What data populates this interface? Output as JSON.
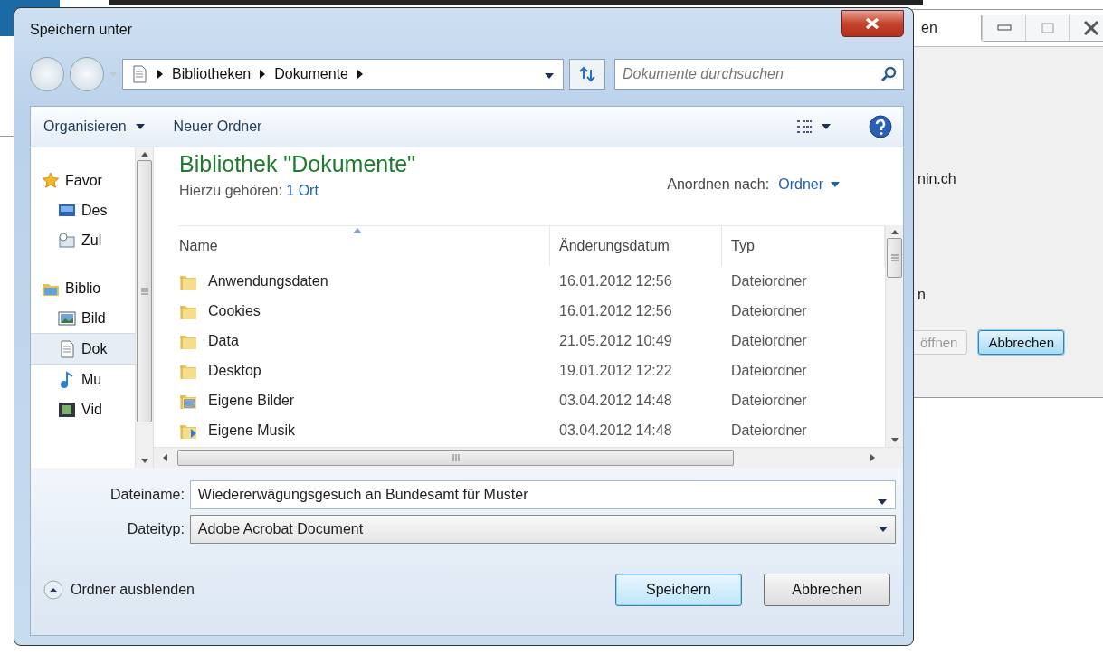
{
  "background_window": {
    "title": "en",
    "texts": [
      "nin.ch",
      "n"
    ],
    "buttons": [
      {
        "label": "öffnen",
        "disabled": true,
        "focused": false
      },
      {
        "label": "Abbrechen",
        "disabled": false,
        "focused": true
      }
    ]
  },
  "dialog": {
    "title": "Speichern unter",
    "breadcrumb": [
      "Bibliotheken",
      "Dokumente"
    ],
    "search": {
      "placeholder": "Dokumente durchsuchen"
    },
    "toolbar": [
      {
        "label": "Organisieren",
        "kind": "menu"
      },
      {
        "label": "Neuer Ordner",
        "kind": "button"
      }
    ],
    "nav_items": [
      {
        "label": "Favor",
        "kind": "favorites",
        "selected": false,
        "children": [
          {
            "label": "Des",
            "kind": "desktop",
            "selected": false
          },
          {
            "label": "Zul",
            "kind": "recent",
            "selected": false
          }
        ]
      },
      {
        "label": "Biblio",
        "kind": "libraries",
        "selected": false,
        "children": [
          {
            "label": "Bild",
            "kind": "pictures",
            "selected": false
          },
          {
            "label": "Dok",
            "kind": "documents",
            "selected": true
          },
          {
            "label": "Mu",
            "kind": "music",
            "selected": false
          },
          {
            "label": "Vid",
            "kind": "videos",
            "selected": false
          }
        ]
      }
    ],
    "library": {
      "title": "Bibliothek \"Dokumente\"",
      "includes_label": "Hierzu gehören:",
      "includes_link": "1 Ort",
      "arrange_label": "Anordnen nach:",
      "arrange_value": "Ordner"
    },
    "table": {
      "columns": [
        "Name",
        "Änderungsdatum",
        "Typ"
      ],
      "rows": [
        {
          "name": "Anwendungsdaten",
          "date": "16.01.2012 12:56",
          "type": "Dateiordner",
          "kind": "folder"
        },
        {
          "name": "Cookies",
          "date": "16.01.2012 12:56",
          "type": "Dateiordner",
          "kind": "folder"
        },
        {
          "name": "Data",
          "date": "21.05.2012 10:49",
          "type": "Dateiordner",
          "kind": "folder"
        },
        {
          "name": "Desktop",
          "date": "19.01.2012 12:22",
          "type": "Dateiordner",
          "kind": "folder"
        },
        {
          "name": "Eigene Bilder",
          "date": "03.04.2012 14:48",
          "type": "Dateiordner",
          "kind": "pictures"
        },
        {
          "name": "Eigene Musik",
          "date": "03.04.2012 14:48",
          "type": "Dateiordner",
          "kind": "music"
        }
      ]
    },
    "filename": {
      "label": "Dateiname:",
      "value": "Wiedererwägungsgesuch an Bundesamt für Muster"
    },
    "filetype": {
      "label": "Dateityp:",
      "value": "Adobe Acrobat Document"
    },
    "hide_folders": "Ordner ausblenden",
    "buttons": [
      {
        "label": "Speichern",
        "default": true
      },
      {
        "label": "Abbrechen",
        "default": false
      }
    ]
  }
}
